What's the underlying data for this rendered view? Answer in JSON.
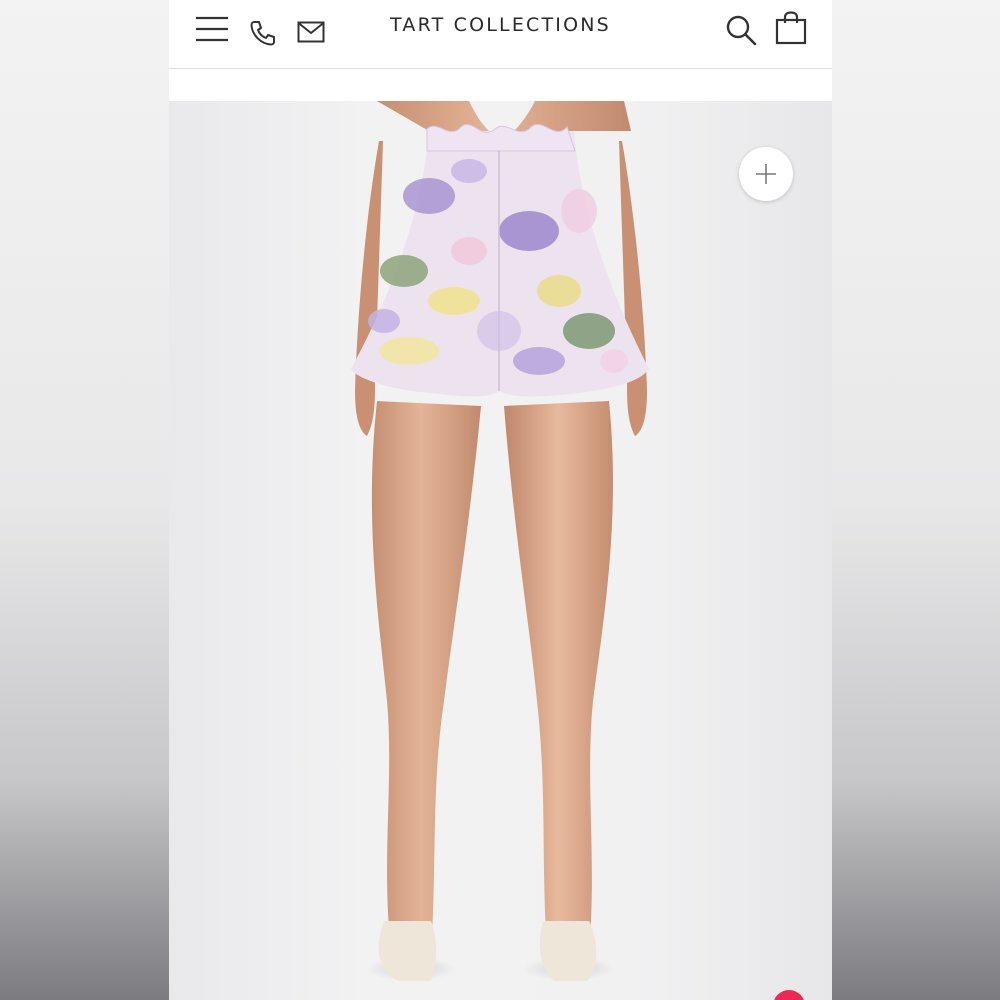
{
  "header": {
    "brand": "TART COLLECTIONS",
    "icons": {
      "menu": "hamburger-menu-icon",
      "phone": "phone-icon",
      "mail": "mail-icon",
      "search": "search-icon",
      "bag": "shopping-bag-icon"
    }
  },
  "product": {
    "zoom_icon": "plus-icon"
  },
  "colors": {
    "accent_badge": "#ea2a55",
    "brand_text": "#2a2a2a"
  }
}
